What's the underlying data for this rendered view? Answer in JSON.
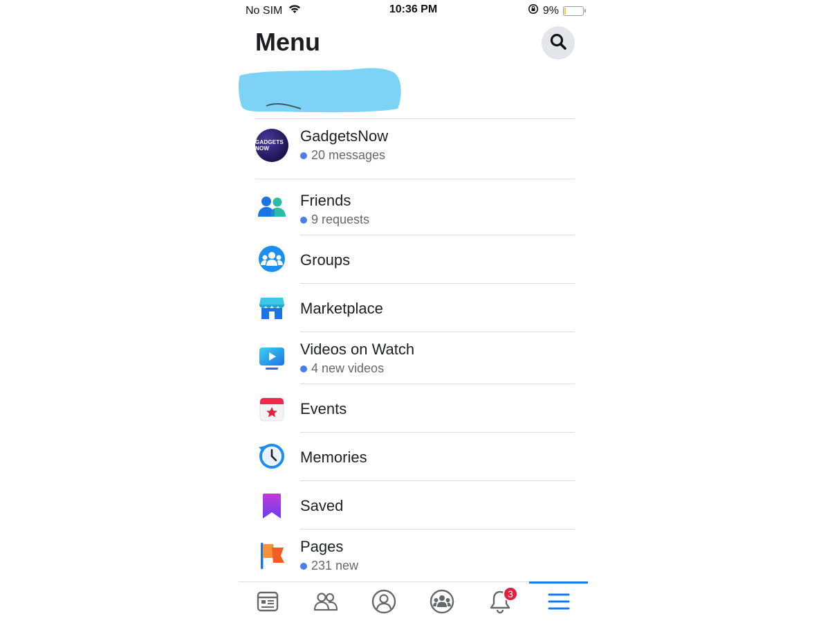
{
  "status_bar": {
    "carrier": "No SIM",
    "time": "10:36 PM",
    "battery": "9%",
    "battery_level": 0.09,
    "icons": [
      "wifi-icon",
      "orientation-lock-icon",
      "battery-icon"
    ]
  },
  "header": {
    "title": "Menu",
    "search_icon": "search-icon"
  },
  "shortcut_page": {
    "name": "GadgetsNow",
    "subtitle": "20 messages",
    "avatar_text": "GADGETS NOW"
  },
  "menu_items": [
    {
      "label": "Friends",
      "subtitle": "9 requests",
      "icon": "friends-icon"
    },
    {
      "label": "Groups",
      "icon": "groups-icon"
    },
    {
      "label": "Marketplace",
      "icon": "marketplace-icon"
    },
    {
      "label": "Videos on Watch",
      "subtitle": "4 new videos",
      "icon": "watch-icon"
    },
    {
      "label": "Events",
      "icon": "events-icon"
    },
    {
      "label": "Memories",
      "icon": "memories-icon"
    },
    {
      "label": "Saved",
      "icon": "saved-icon"
    },
    {
      "label": "Pages",
      "subtitle": "231 new",
      "icon": "pages-icon"
    }
  ],
  "tab_bar": {
    "tabs": [
      {
        "icon": "news-feed-icon"
      },
      {
        "icon": "friends-tab-icon"
      },
      {
        "icon": "profile-icon"
      },
      {
        "icon": "groups-tab-icon"
      },
      {
        "icon": "notifications-icon",
        "badge": "3"
      },
      {
        "icon": "menu-icon",
        "active": true
      }
    ]
  },
  "colors": {
    "accent": "#1877f2",
    "badge": "#e41e3f",
    "unread_dot": "#4a7ee8",
    "redaction": "#7dd3f5"
  }
}
